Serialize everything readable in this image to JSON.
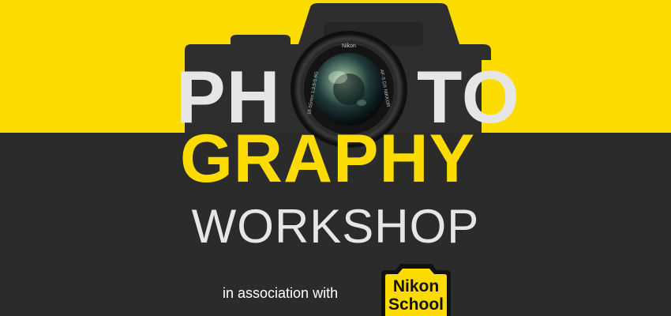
{
  "headline": {
    "photo_left": "PH",
    "photo_right": "TO",
    "graphy": "GRAPHY",
    "workshop": "WORKSHOP"
  },
  "association": {
    "text": "in association with"
  },
  "badge": {
    "line1": "Nikon",
    "line2": "School"
  },
  "lens": {
    "brand": "Nikon",
    "specs": "AF-S DX NIKKOR",
    "focal": "18-55mm 1:3.5-5.6G"
  },
  "colors": {
    "yellow": "#fcdc00",
    "dark": "#2b2b2b",
    "light_text": "#e6e6e6"
  },
  "icons": {
    "camera": "camera-silhouette-icon",
    "lens": "camera-lens-icon"
  }
}
